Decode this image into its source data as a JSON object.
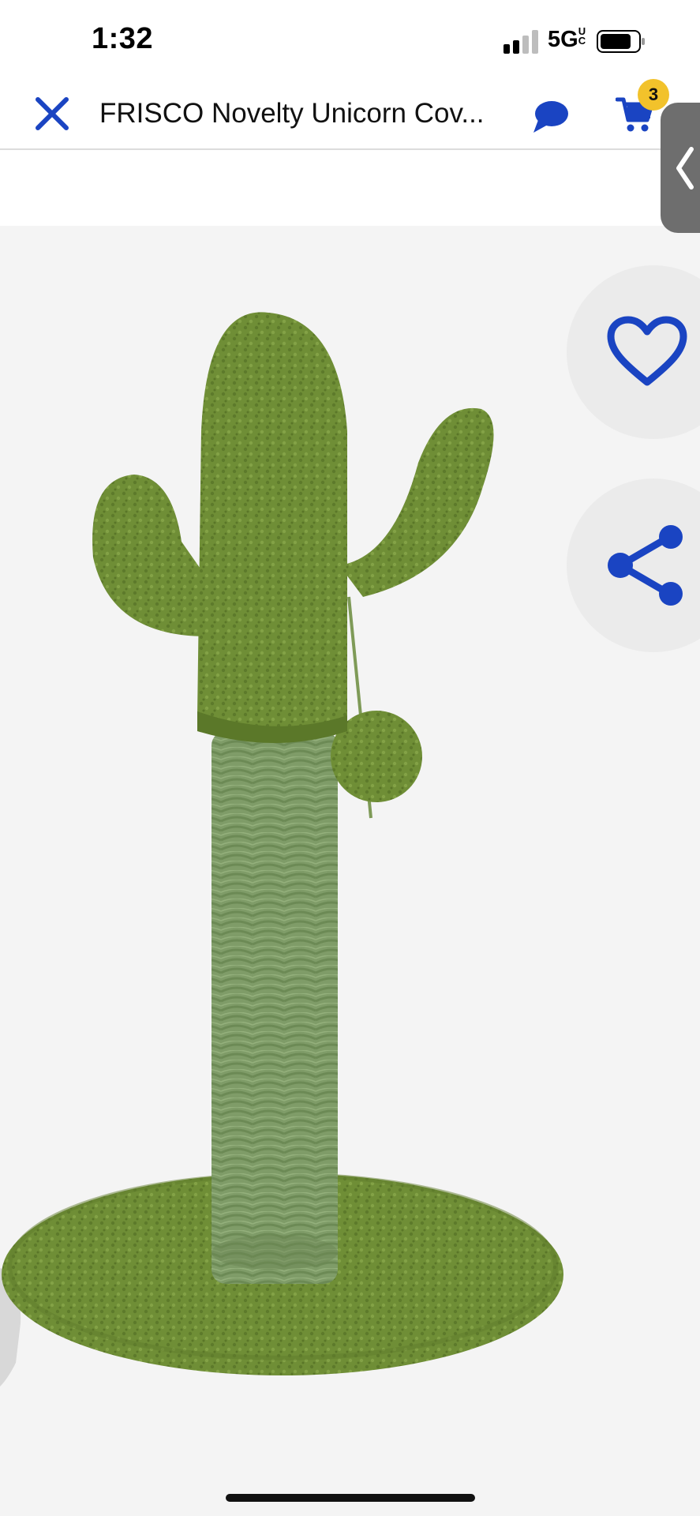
{
  "status_bar": {
    "time": "1:32",
    "network": "5G",
    "network_suffix": "UC"
  },
  "header": {
    "title": "FRISCO Novelty Unicorn Cov...",
    "close_icon": "close-icon",
    "chat_icon": "chat-bubble-icon",
    "cart_icon": "cart-icon",
    "cart_count": "3"
  },
  "side_tab": {
    "icon": "chevron-left-icon"
  },
  "product_image": {
    "subject": "green cactus cat scratching post with pom-pom toy"
  },
  "actions": {
    "favorite_icon": "heart-icon",
    "share_icon": "share-icon"
  },
  "colors": {
    "accent": "#1a44c2",
    "badge": "#f2c22b",
    "cactus": "#6f8e36",
    "rope": "#7f9c68"
  }
}
